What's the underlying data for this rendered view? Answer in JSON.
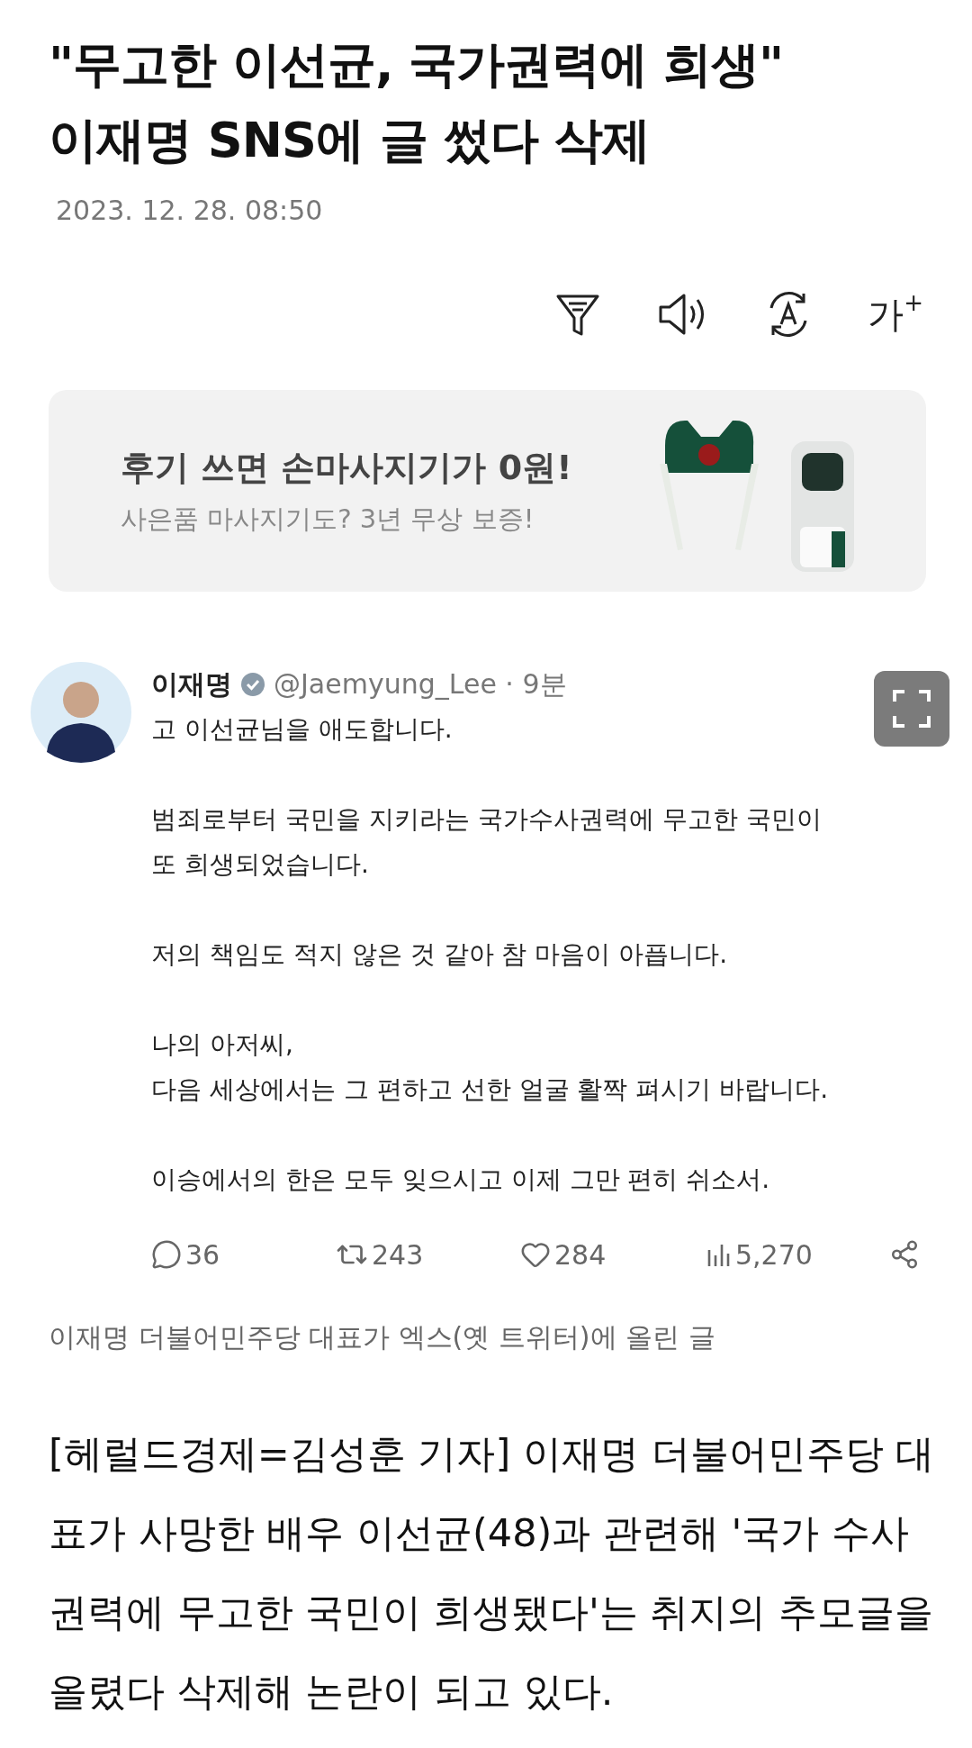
{
  "headline": {
    "lines": [
      "\"무고한 이선균, 국가권력에 희생\"",
      "이재명 SNS에 글 썼다 삭제"
    ]
  },
  "date": "2023. 12. 28. 08:50",
  "toolbar": {
    "font_size_label": "가$^{+}$"
  },
  "ad": {
    "title": "후기 쓰면 손마사지기가 0원!",
    "subtitle": "사은품 마사지기도? 3년 무상 보증!"
  },
  "tweet": {
    "name": "이재명",
    "verified": true,
    "handle": "@Jaemyung_Lee · 9분",
    "paragraphs": [
      [
        "고 이선균님을 애도합니다."
      ],
      [
        "범죄로부터 국민을 지키라는 국가수사권력에 무고한 국민이",
        "또 희생되었습니다."
      ],
      [
        "저의 책임도 적지 않은 것 같아 참 마음이 아픕니다."
      ],
      [
        "나의 아저씨,",
        "다음 세상에서는 그 편하고 선한 얼굴 활짝 펴시기 바랍니다."
      ],
      [
        "이승에서의 한은 모두 잊으시고 이제 그만 편히 쉬소서."
      ]
    ],
    "stats": [
      {
        "kind": "reply",
        "count": "36"
      },
      {
        "kind": "repost",
        "count": "243"
      },
      {
        "kind": "like",
        "count": "284"
      },
      {
        "kind": "views",
        "count": "5,270"
      },
      {
        "kind": "share"
      }
    ]
  },
  "caption": "이재명 더불어민주당 대표가 엑스(옛 트위터)에 올린 글",
  "body_lines": [
    "[헤럴드경제=김성훈 기자] 이재명 더불어민주당 대",
    "표가 사망한 배우 이선균(48)과 관련해 '국가 수사",
    "권력에 무고한 국민이 희생됐다'는 취지의 추모글을",
    "올렸다 삭제해 논란이 되고 있다."
  ]
}
